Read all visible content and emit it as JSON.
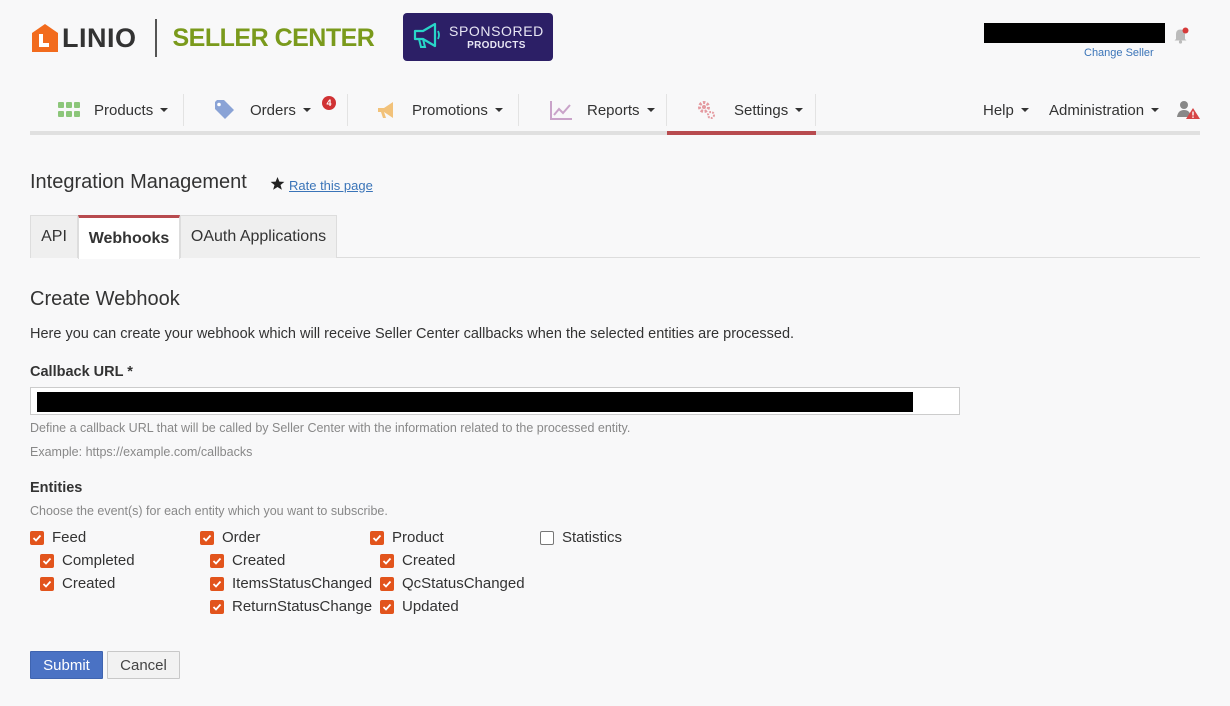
{
  "header": {
    "brand_name": "LINIO",
    "brand_product": "SELLER CENTER",
    "sponsored_line1": "SPONSORED",
    "sponsored_line2": "PRODUCTS",
    "change_seller": "Change Seller"
  },
  "nav": {
    "items": [
      {
        "label": "Products",
        "icon": "grid-icon"
      },
      {
        "label": "Orders",
        "icon": "tag-icon",
        "badge": "4"
      },
      {
        "label": "Promotions",
        "icon": "megaphone-icon"
      },
      {
        "label": "Reports",
        "icon": "chart-icon"
      },
      {
        "label": "Settings",
        "icon": "gear-icon"
      }
    ],
    "right": {
      "help": "Help",
      "administration": "Administration"
    },
    "active": "Settings"
  },
  "page": {
    "title": "Integration Management",
    "rate_link": "Rate this page"
  },
  "tabs": [
    {
      "label": "API"
    },
    {
      "label": "Webhooks"
    },
    {
      "label": "OAuth Applications"
    }
  ],
  "form": {
    "heading": "Create Webhook",
    "description": "Here you can create your webhook which will receive Seller Center callbacks when the selected entities are processed.",
    "callback_label": "Callback URL *",
    "callback_help": "Define a callback URL that will be called by Seller Center with the information related to the processed entity.",
    "callback_example": "Example: https://example.com/callbacks",
    "entities_label": "Entities",
    "entities_help": "Choose the event(s) for each entity which you want to subscribe.",
    "entities": [
      {
        "name": "Feed",
        "checked": true,
        "events": [
          {
            "name": "Completed",
            "checked": true
          },
          {
            "name": "Created",
            "checked": true
          }
        ]
      },
      {
        "name": "Order",
        "checked": true,
        "events": [
          {
            "name": "Created",
            "checked": true
          },
          {
            "name": "ItemsStatusChanged",
            "checked": true
          },
          {
            "name": "ReturnStatusChange",
            "checked": true
          }
        ]
      },
      {
        "name": "Product",
        "checked": true,
        "events": [
          {
            "name": "Created",
            "checked": true
          },
          {
            "name": "QcStatusChanged",
            "checked": true
          },
          {
            "name": "Updated",
            "checked": true
          }
        ]
      },
      {
        "name": "Statistics",
        "checked": false,
        "events": []
      }
    ],
    "submit": "Submit",
    "cancel": "Cancel"
  },
  "colors": {
    "accent_active": "#b84b4f",
    "checkbox": "#e2541c",
    "link": "#3a74b8",
    "brand_green": "#7a9a1c",
    "submit": "#4a72c4"
  }
}
